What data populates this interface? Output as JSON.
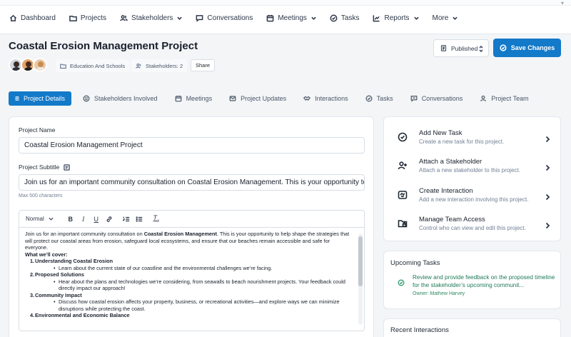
{
  "nav": {
    "items": [
      {
        "label": "Dashboard",
        "icon": "home-icon"
      },
      {
        "label": "Projects",
        "icon": "folder-icon"
      },
      {
        "label": "Stakeholders",
        "icon": "users-icon",
        "dropdown": true
      },
      {
        "label": "Conversations",
        "icon": "chat-icon"
      },
      {
        "label": "Meetings",
        "icon": "calendar-icon",
        "dropdown": true
      },
      {
        "label": "Tasks",
        "icon": "check-circle-icon"
      },
      {
        "label": "Reports",
        "icon": "chart-icon",
        "dropdown": true
      },
      {
        "label": "More",
        "icon": "",
        "dropdown": true
      }
    ]
  },
  "header": {
    "title": "Coastal Erosion Management Project",
    "category": "Education And Schools",
    "stakeholders_count": "Stakeholders: 2",
    "share_label": "Share",
    "status": "Published",
    "save_label": "Save Changes"
  },
  "tabs": [
    {
      "label": "Project Details",
      "icon": "file-icon",
      "active": true
    },
    {
      "label": "Stakeholders Involved",
      "icon": "smile-icon"
    },
    {
      "label": "Meetings",
      "icon": "calendar-icon"
    },
    {
      "label": "Project Updates",
      "icon": "mail-icon"
    },
    {
      "label": "Interactions",
      "icon": "handshake-icon"
    },
    {
      "label": "Tasks",
      "icon": "check-circle-icon"
    },
    {
      "label": "Conversations",
      "icon": "message-icon"
    },
    {
      "label": "Project Team",
      "icon": "user-icon"
    }
  ],
  "form": {
    "name_label": "Project Name",
    "name_value": "Coastal Erosion Management Project",
    "subtitle_label": "Project Subtitle",
    "subtitle_value": "Join us for an important community consultation on Coastal Erosion Management. This is your opportunity to he",
    "subtitle_hint": "Max 500 characters",
    "editor_format": "Normal",
    "editor": {
      "intro_a": "Join us for an important community consultation on ",
      "intro_bold": "Coastal Erosion Management",
      "intro_b": ". This is your opportunity to help shape the strategies that will protect our coastal areas from erosion, safeguard local ecosystems, and ensure that our beaches remain accessible and safe for everyone.",
      "cover_heading": "What we’ll cover:",
      "items": [
        {
          "num": "1.",
          "title": "Understanding Coastal Erosion",
          "bullet": "Learn about the current state of our coastline and the environmental challenges we’re facing."
        },
        {
          "num": "2.",
          "title": "Proposed Solutions",
          "bullet": "Hear about the plans and technologies we’re considering, from seawalls to beach nourishment projects. Your feedback could directly impact our approach!"
        },
        {
          "num": "3.",
          "title": "Community Impact",
          "bullet": "Discuss how coastal erosion affects your property, business, or recreational activities—and explore ways we can minimize disruptions while protecting the coast."
        },
        {
          "num": "4.",
          "title": "Environmental and Economic Balance",
          "bullet": ""
        }
      ]
    }
  },
  "actions": [
    {
      "title": "Add New Task",
      "desc": "Create a new task for this project.",
      "icon": "check-circle-icon"
    },
    {
      "title": "Attach a Stakeholder",
      "desc": "Attach a new stakeholder to this project.",
      "icon": "user-plus-icon"
    },
    {
      "title": "Create Interaction",
      "desc": "Add a new interaction involving this project.",
      "icon": "handshake-icon"
    },
    {
      "title": "Manage Team Access",
      "desc": "Control who can view and edit this project.",
      "icon": "folder-lock-icon"
    }
  ],
  "upcoming": {
    "title": "Upcoming Tasks",
    "task_text": "Review and provide feedback on the proposed timeline for the stakeholder’s upcoming communit...",
    "owner": "Owner: Mathew Harvey"
  },
  "recent": {
    "title": "Recent Interactions"
  },
  "colors": {
    "accent": "#1379c9",
    "task_green": "#1f7a57"
  }
}
